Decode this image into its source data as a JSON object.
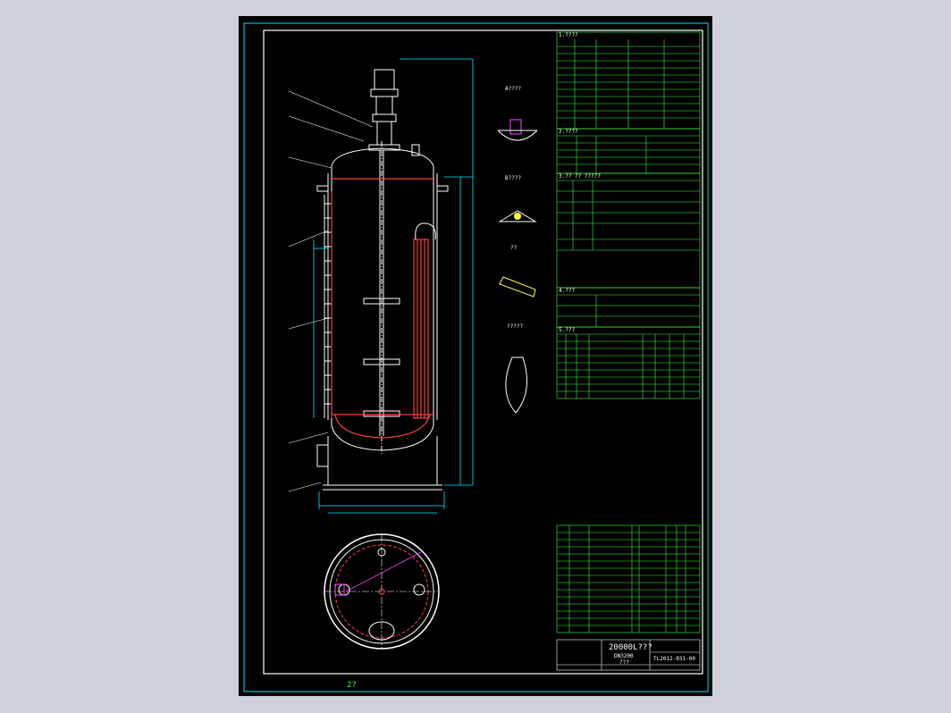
{
  "drawing": {
    "title_line1": "20000L???",
    "title_line2": "DN3200",
    "title_line3": "???",
    "drawing_number": "TL2012-031-00",
    "bottom_caption": "2?"
  },
  "tables": {
    "design_data_header": "1.????",
    "sections": [
      {
        "header": "2.????"
      },
      {
        "header": "3.?? ?? ?????"
      },
      {
        "header": "4.???"
      },
      {
        "header": "5.???"
      }
    ]
  },
  "details": {
    "detail_a": "A????",
    "detail_b": "B????",
    "detail_c": "??",
    "detail_d": "?????"
  },
  "colors": {
    "background": "#000000",
    "frame": "#00e5ff",
    "table": "#3cff3c",
    "vessel": "#ffffff",
    "coil": "#ff3c3c",
    "dimension": "#00e5ff",
    "accent": "#ff40ff"
  }
}
